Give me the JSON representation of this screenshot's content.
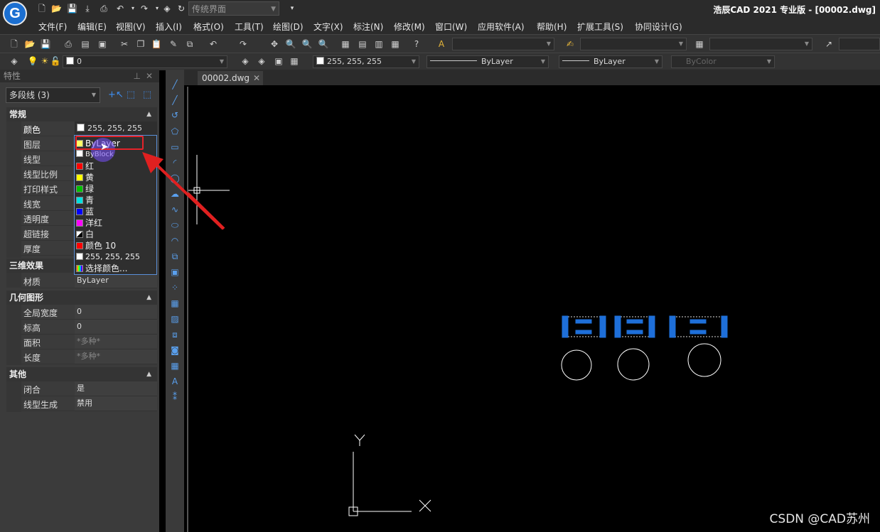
{
  "title_bar": {
    "workspace": "传统界面",
    "app_title": "浩辰CAD 2021 专业版 - [00002.dwg]"
  },
  "menu": [
    "文件(F)",
    "编辑(E)",
    "视图(V)",
    "插入(I)",
    "格式(O)",
    "工具(T)",
    "绘图(D)",
    "文字(X)",
    "标注(N)",
    "修改(M)",
    "窗口(W)",
    "应用软件(A)",
    "帮助(H)",
    "扩展工具(S)",
    "协同设计(G)"
  ],
  "layer_toolbar": {
    "layer": "0",
    "color": "255, 255, 255",
    "linetype": "ByLayer",
    "lineweight": "ByLayer",
    "plotstyle": "ByColor"
  },
  "properties_panel": {
    "title": "特性",
    "object_type": "多段线 (3)",
    "sections": {
      "general": "常规",
      "3d": "三维效果",
      "geometry": "几何图形",
      "other": "其他"
    },
    "rows": {
      "color": {
        "label": "颜色",
        "value": "255, 255, 255"
      },
      "layer": {
        "label": "图层"
      },
      "linetype": {
        "label": "线型"
      },
      "linetype_scale": {
        "label": "线型比例"
      },
      "plot_style": {
        "label": "打印样式"
      },
      "lineweight": {
        "label": "线宽"
      },
      "transparency": {
        "label": "透明度"
      },
      "hyperlink": {
        "label": "超链接"
      },
      "thickness": {
        "label": "厚度"
      },
      "material": {
        "label": "材质",
        "value": "ByLayer"
      },
      "global_width": {
        "label": "全局宽度",
        "value": "0"
      },
      "elevation": {
        "label": "标高",
        "value": "0"
      },
      "area": {
        "label": "面积",
        "value": "*多种*"
      },
      "length": {
        "label": "长度",
        "value": "*多种*"
      },
      "closed": {
        "label": "闭合",
        "value": "是"
      },
      "linetype_gen": {
        "label": "线型生成",
        "value": "禁用"
      }
    }
  },
  "color_dropdown": {
    "items": [
      {
        "label": "ByLayer",
        "color": "#ffff66"
      },
      {
        "label": "ByBlock",
        "color": "#ffffff"
      },
      {
        "label": "红",
        "color": "#ff0000"
      },
      {
        "label": "黄",
        "color": "#ffff00"
      },
      {
        "label": "绿",
        "color": "#00c000"
      },
      {
        "label": "青",
        "color": "#00e0e0"
      },
      {
        "label": "蓝",
        "color": "#0000ff"
      },
      {
        "label": "洋红",
        "color": "#ff00ff"
      },
      {
        "label": "白",
        "color": "#ffffff"
      },
      {
        "label": "颜色 10",
        "color": "#ff0000"
      },
      {
        "label": "255, 255, 255",
        "color": "#ffffff"
      },
      {
        "label": "选择颜色...",
        "color": "multicolor"
      }
    ],
    "highlighted": "ByLayer"
  },
  "document_tab": "00002.dwg",
  "watermark": "CSDN @CAD苏州",
  "accent_colors": {
    "selection": "#1e6fd9",
    "highlight_box": "#e5232a",
    "arrow": "#e02020"
  }
}
